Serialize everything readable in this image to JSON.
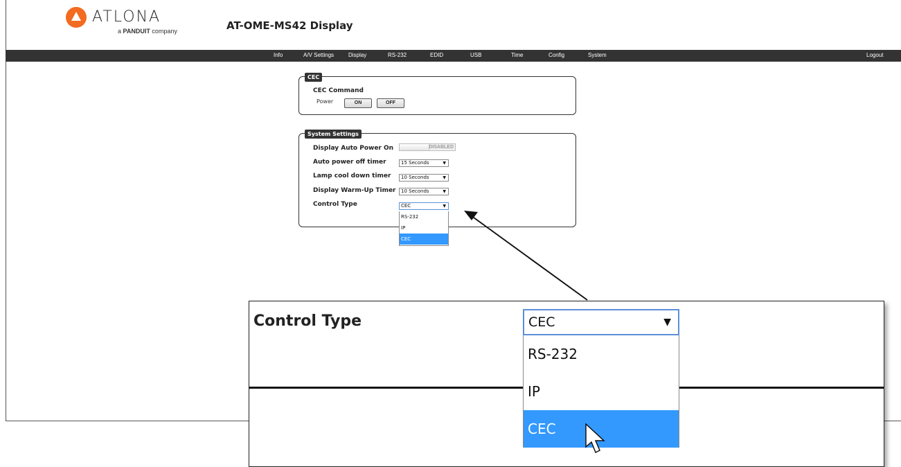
{
  "header": {
    "logo_text": "ATLONA",
    "logo_sub_prefix": "a",
    "logo_sub_brand": "PANDUIT",
    "logo_sub_suffix": "company",
    "title": "AT-OME-MS42  Display"
  },
  "nav": {
    "items": [
      "Info",
      "A/V Settings",
      "Display",
      "RS-232",
      "EDID",
      "USB",
      "Time",
      "Config",
      "System"
    ],
    "logout": "Logout"
  },
  "cec_panel": {
    "legend": "CEC",
    "heading": "CEC Command",
    "power_label": "Power",
    "on_button": "ON",
    "off_button": "OFF"
  },
  "system_panel": {
    "legend": "System Settings",
    "auto_power_on_label": "Display Auto Power On",
    "auto_power_on_state": "DISABLED",
    "auto_power_off_label": "Auto power off timer",
    "auto_power_off_value": "15 Seconds",
    "lamp_cool_label": "Lamp cool down timer",
    "lamp_cool_value": "10 Seconds",
    "warmup_label": "Display Warm-Up Timer",
    "warmup_value": "10 Seconds",
    "control_type_label": "Control Type",
    "control_type_value": "CEC",
    "control_type_options": [
      "RS-232",
      "IP",
      "CEC"
    ]
  },
  "zoom_callout": {
    "label": "Control Type",
    "value": "CEC",
    "options": [
      "RS-232",
      "IP",
      "CEC"
    ]
  },
  "icons": {
    "dropdown_arrow": "▼",
    "logo_icon": "atlona-logo-icon",
    "pointer": "mouse-pointer-icon"
  },
  "colors": {
    "nav_bg": "#333333",
    "logo_orange": "#f26b21",
    "selected_option": "#3399ff",
    "focus_border": "#5b8fd8"
  }
}
